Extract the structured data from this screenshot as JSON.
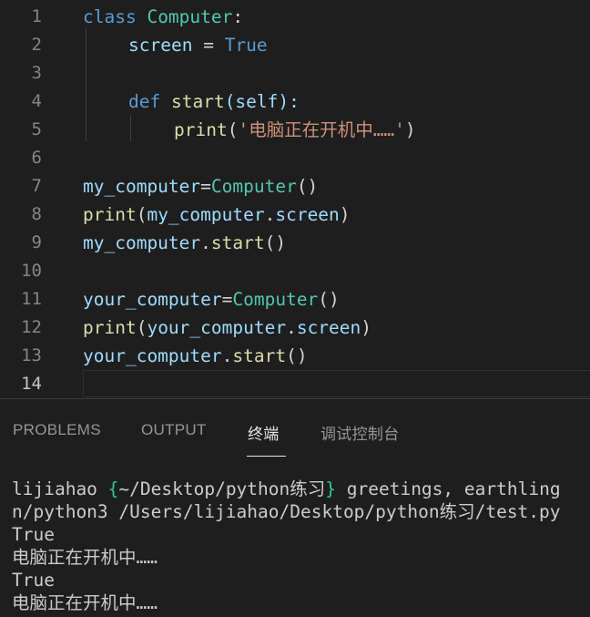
{
  "editor": {
    "line_numbers": [
      "1",
      "2",
      "3",
      "4",
      "5",
      "6",
      "7",
      "8",
      "9",
      "10",
      "11",
      "12",
      "13",
      "14"
    ],
    "active_line": "14",
    "tokens": {
      "class_kw": "class",
      "class_name": "Computer",
      "colon1": ":",
      "screen_var": "screen",
      "eq": " = ",
      "true_val": "True",
      "def_kw": "def",
      "start_fn": "start",
      "self_param": "(self):",
      "print_fn": "print",
      "open_paren": "(",
      "string_val": "'电脑正在开机中……'",
      "close_paren": ")",
      "my_computer": "my_computer",
      "assign": "=",
      "call_parens": "()",
      "dot": ".",
      "screen_attr": "screen",
      "your_computer": "your_computer"
    }
  },
  "panel": {
    "tabs": [
      {
        "label": "PROBLEMS"
      },
      {
        "label": "OUTPUT"
      },
      {
        "label": "终端"
      },
      {
        "label": "调试控制台"
      }
    ],
    "active_tab": "终端",
    "terminal": {
      "prompt_user": "lijiahao ",
      "brace_open": "{",
      "prompt_path": "~/Desktop/python练习",
      "brace_close": "}",
      "prompt_rest": " greetings, earthling",
      "line2": "n/python3 /Users/lijiahao/Desktop/python练习/test.py",
      "line3": "True",
      "line4": "电脑正在开机中……",
      "line5": "True",
      "line6": "电脑正在开机中……"
    }
  },
  "colors": {
    "background": "#1e1e1e",
    "keyword": "#569cd6",
    "class": "#4ec9b0",
    "variable": "#9cdcfe",
    "function": "#dcdcaa",
    "string": "#ce9178"
  }
}
